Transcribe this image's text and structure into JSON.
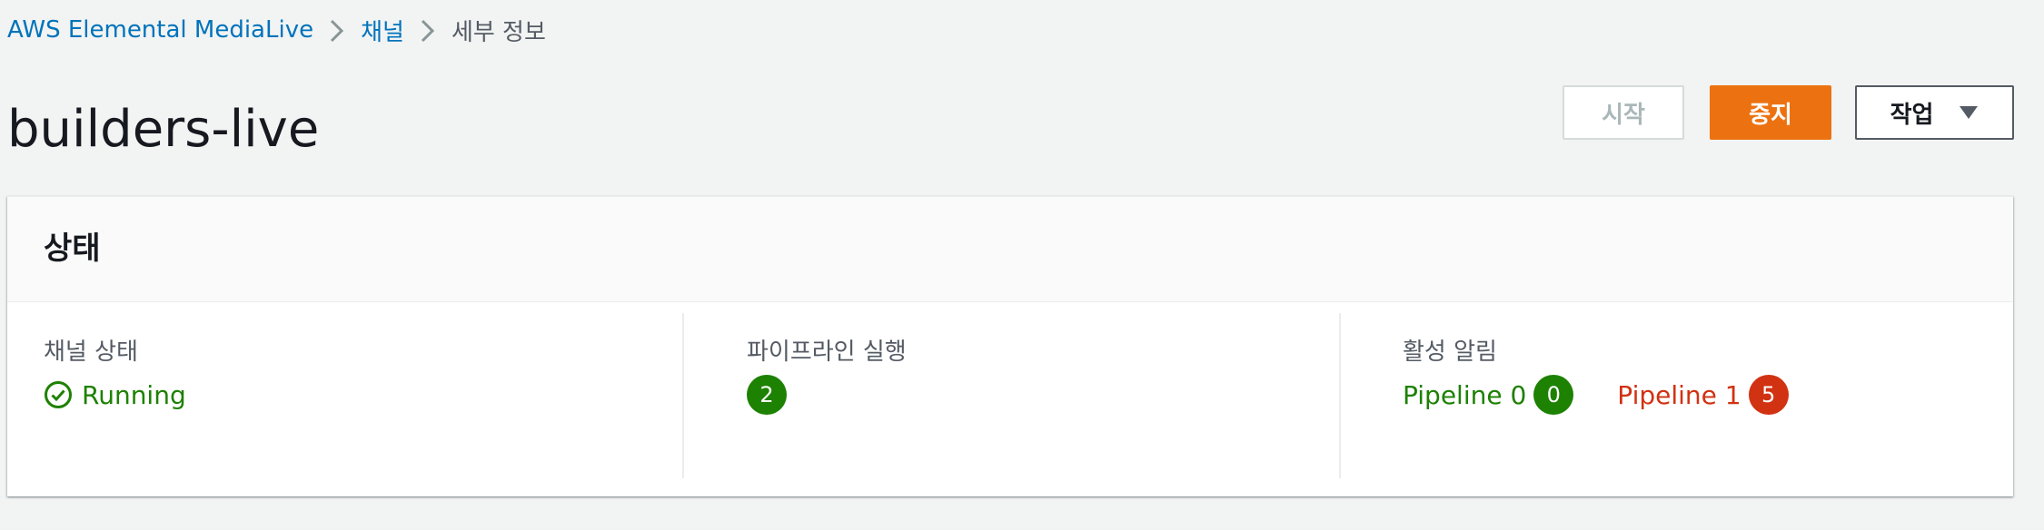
{
  "breadcrumb": {
    "items": [
      {
        "label": "AWS Elemental MediaLive"
      },
      {
        "label": "채널"
      },
      {
        "label": "세부 정보"
      }
    ]
  },
  "page": {
    "title": "builders-live"
  },
  "actions": {
    "start_label": "시작",
    "stop_label": "중지",
    "actions_label": "작업"
  },
  "status_panel": {
    "title": "상태",
    "channel_state": {
      "label": "채널 상태",
      "value": "Running"
    },
    "pipelines_running": {
      "label": "파이프라인 실행",
      "count": "2"
    },
    "active_alarms": {
      "label": "활성 알림",
      "items": [
        {
          "name": "Pipeline 0",
          "count": "0",
          "status": "ok"
        },
        {
          "name": "Pipeline 1",
          "count": "5",
          "status": "error"
        }
      ]
    }
  },
  "icons": {
    "breadcrumb_separator": "chevron-right-icon",
    "actions_caret": "caret-down-icon",
    "running_status": "check-circle-icon"
  },
  "colors": {
    "link": "#0073bb",
    "primary_button": "#ec7211",
    "success": "#1d8102",
    "error": "#d13212",
    "background": "#f2f3f3"
  }
}
